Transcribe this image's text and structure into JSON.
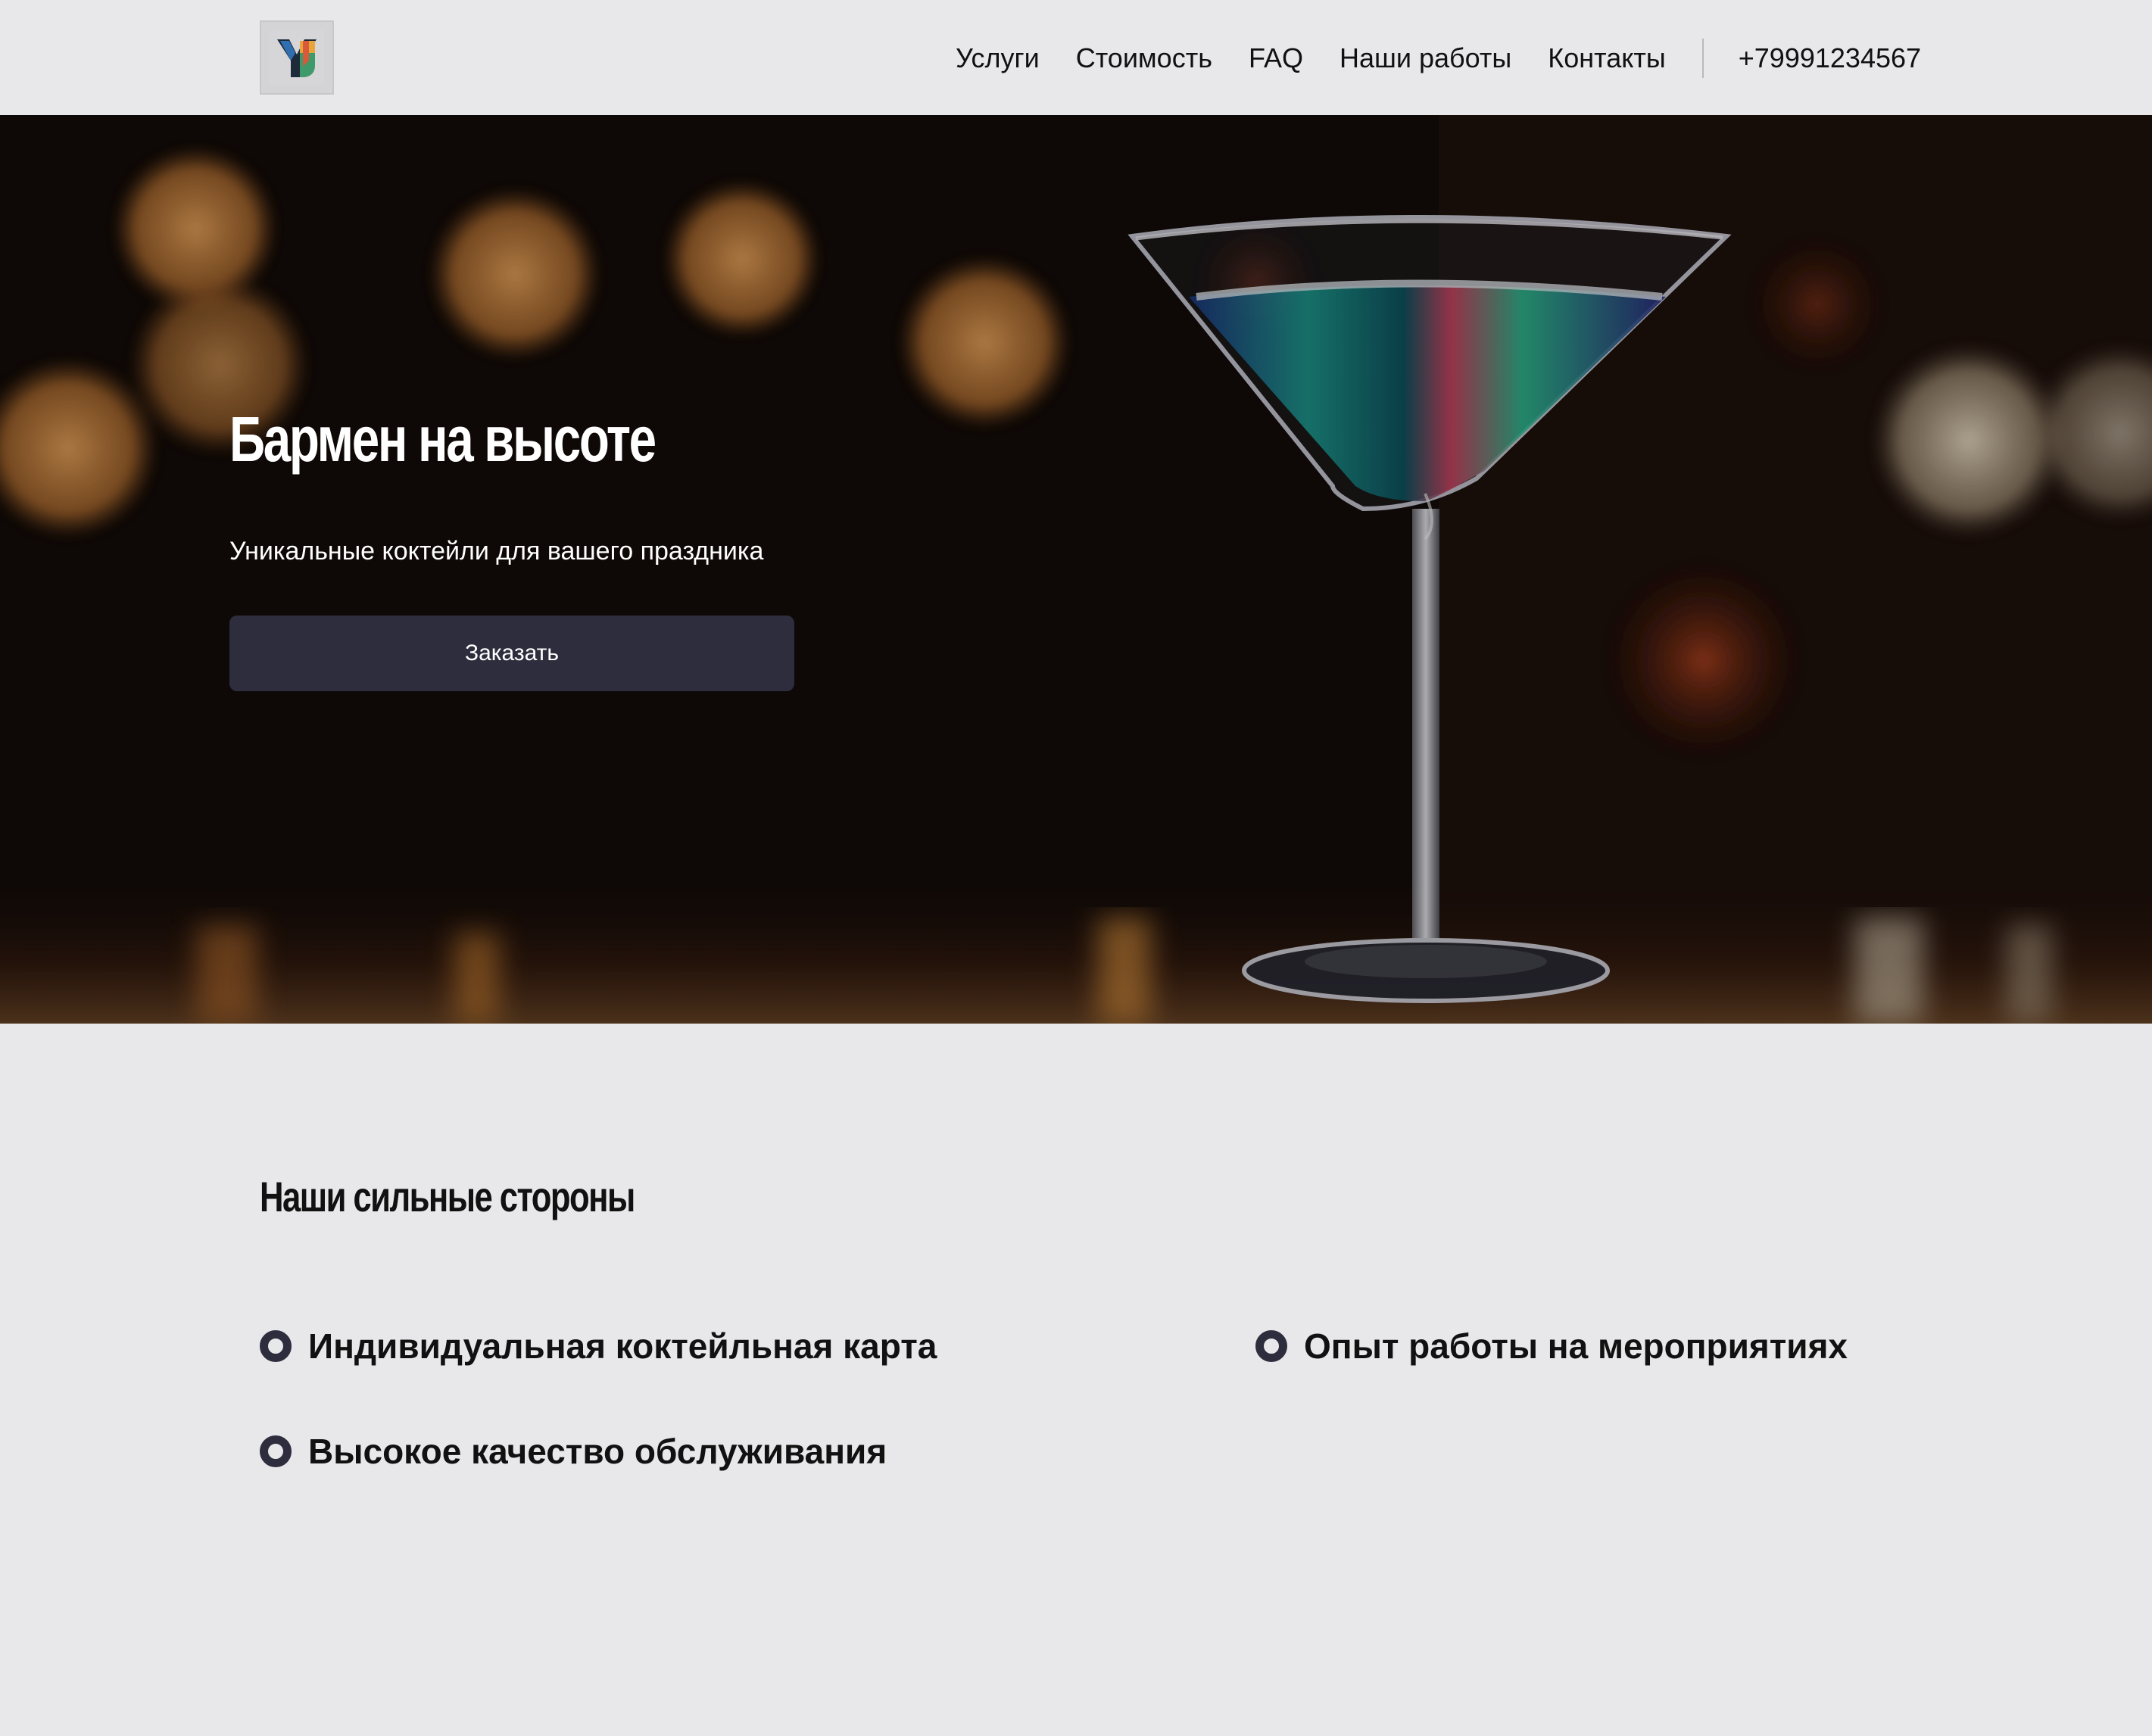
{
  "header": {
    "logo_alt": "Y logo",
    "nav": [
      {
        "label": "Услуги"
      },
      {
        "label": "Стоимость"
      },
      {
        "label": "FAQ"
      },
      {
        "label": "Наши работы"
      },
      {
        "label": "Контакты"
      }
    ],
    "phone": "+79991234567"
  },
  "hero": {
    "title": "Бармен на высоте",
    "subtitle": "Уникальные коктейли для вашего праздника",
    "button_label": "Заказать"
  },
  "strengths": {
    "title": "Наши сильные стороны",
    "items": [
      {
        "label": "Индивидуальная коктейльная карта"
      },
      {
        "label": "Опыт работы на мероприятиях"
      },
      {
        "label": "Высокое качество обслуживания"
      }
    ]
  },
  "colors": {
    "page_bg": "#e8e8ea",
    "button_bg": "#2d2d3d",
    "text_dark": "#111111",
    "text_light": "#ffffff"
  }
}
